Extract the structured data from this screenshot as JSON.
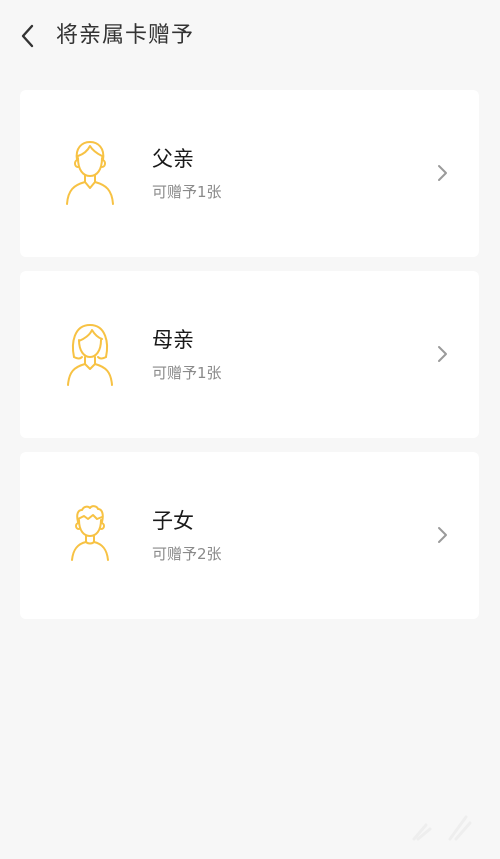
{
  "header": {
    "title": "将亲属卡赠予",
    "back_icon": "chevron-left-icon"
  },
  "colors": {
    "background": "#f7f7f7",
    "card": "#ffffff",
    "accent": "#f7c244",
    "text_primary": "#1a1a1a",
    "text_secondary": "#8a8a8a"
  },
  "relatives": [
    {
      "name": "父亲",
      "subtitle": "可赠予1张",
      "icon": "father-avatar-icon"
    },
    {
      "name": "母亲",
      "subtitle": "可赠予1张",
      "icon": "mother-avatar-icon"
    },
    {
      "name": "子女",
      "subtitle": "可赠予2张",
      "icon": "child-avatar-icon"
    }
  ]
}
